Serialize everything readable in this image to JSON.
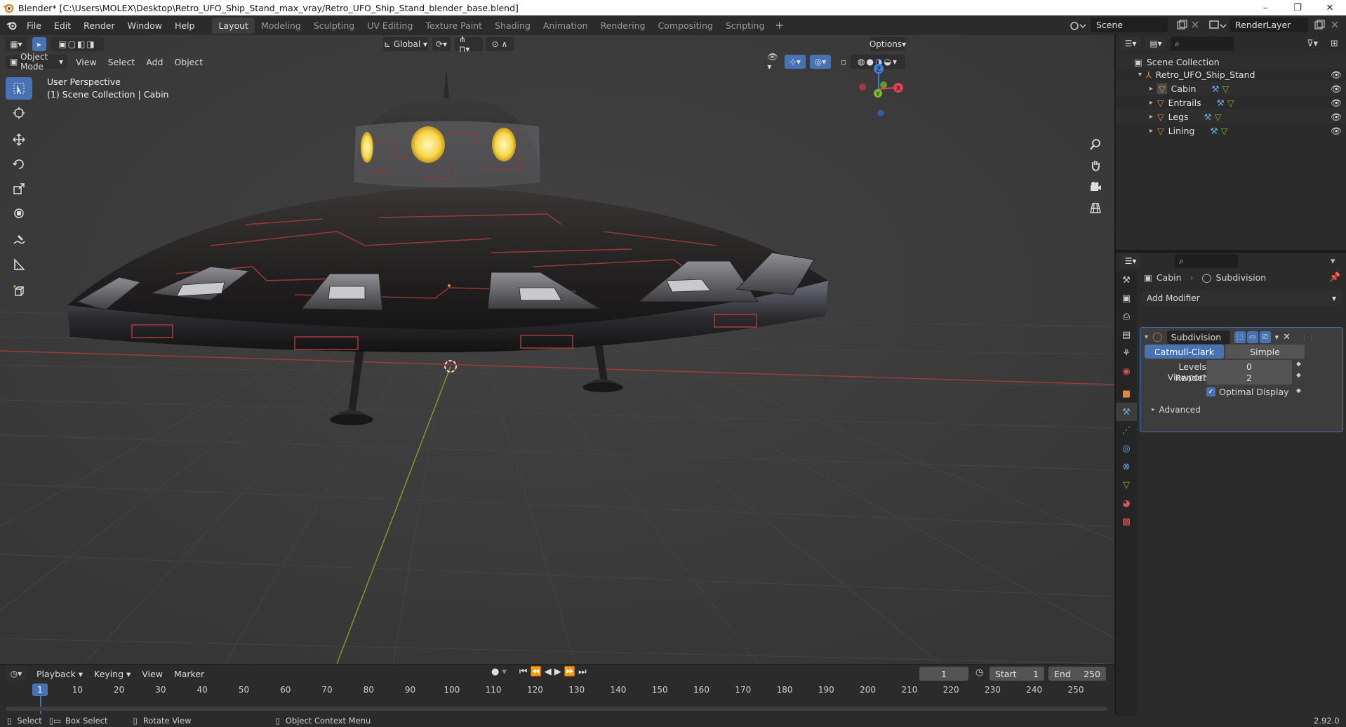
{
  "window": {
    "title": "Blender* [C:\\Users\\MOLEX\\Desktop\\Retro_UFO_Ship_Stand_max_vray/Retro_UFO_Ship_Stand_blender_base.blend]",
    "minimize": "–",
    "maximize": "❐",
    "close": "✕"
  },
  "menu": {
    "file": "File",
    "edit": "Edit",
    "render": "Render",
    "window": "Window",
    "help": "Help"
  },
  "workspaces": [
    "Layout",
    "Modeling",
    "Sculpting",
    "UV Editing",
    "Texture Paint",
    "Shading",
    "Animation",
    "Rendering",
    "Compositing",
    "Scripting"
  ],
  "scene": {
    "name": "Scene",
    "render_layer": "RenderLayer"
  },
  "viewport": {
    "orientation": "Global",
    "options": "Options",
    "mode": "Object Mode",
    "menus": [
      "View",
      "Select",
      "Add",
      "Object"
    ],
    "info_line1": "User Perspective",
    "info_line2": "(1) Scene Collection | Cabin",
    "gizmo": {
      "x": "X",
      "y": "Y",
      "z": "Z"
    }
  },
  "outliner": {
    "root": "Scene Collection",
    "collection": "Retro_UFO_Ship_Stand",
    "objects": [
      "Cabin",
      "Entrails",
      "Legs",
      "Lining"
    ]
  },
  "properties": {
    "breadcrumb_object": "Cabin",
    "breadcrumb_modifier": "Subdivision",
    "add_modifier": "Add Modifier",
    "modifier_name": "Subdivision",
    "type_catmull": "Catmull-Clark",
    "type_simple": "Simple",
    "levels_viewport_label": "Levels Viewport",
    "levels_viewport_value": "0",
    "render_label": "Render",
    "render_value": "2",
    "optimal_display": "Optimal Display",
    "advanced": "Advanced"
  },
  "timeline": {
    "menus": [
      "Playback",
      "Keying",
      "View",
      "Marker"
    ],
    "current_frame": "1",
    "start_label": "Start",
    "start_value": "1",
    "end_label": "End",
    "end_value": "250",
    "ruler": [
      "1",
      "10",
      "20",
      "30",
      "40",
      "50",
      "60",
      "70",
      "80",
      "90",
      "100",
      "110",
      "120",
      "130",
      "140",
      "150",
      "160",
      "170",
      "180",
      "190",
      "200",
      "210",
      "220",
      "230",
      "240",
      "250"
    ]
  },
  "status": {
    "select": "Select",
    "box_select": "Box Select",
    "rotate_view": "Rotate View",
    "context_menu": "Object Context Menu",
    "version": "2.92.0"
  },
  "colors": {
    "accent": "#4772b3",
    "x_axis": "#e0444e",
    "y_axis": "#7fbb28",
    "z_axis": "#3c7ed8",
    "object": "#e08a3c"
  }
}
